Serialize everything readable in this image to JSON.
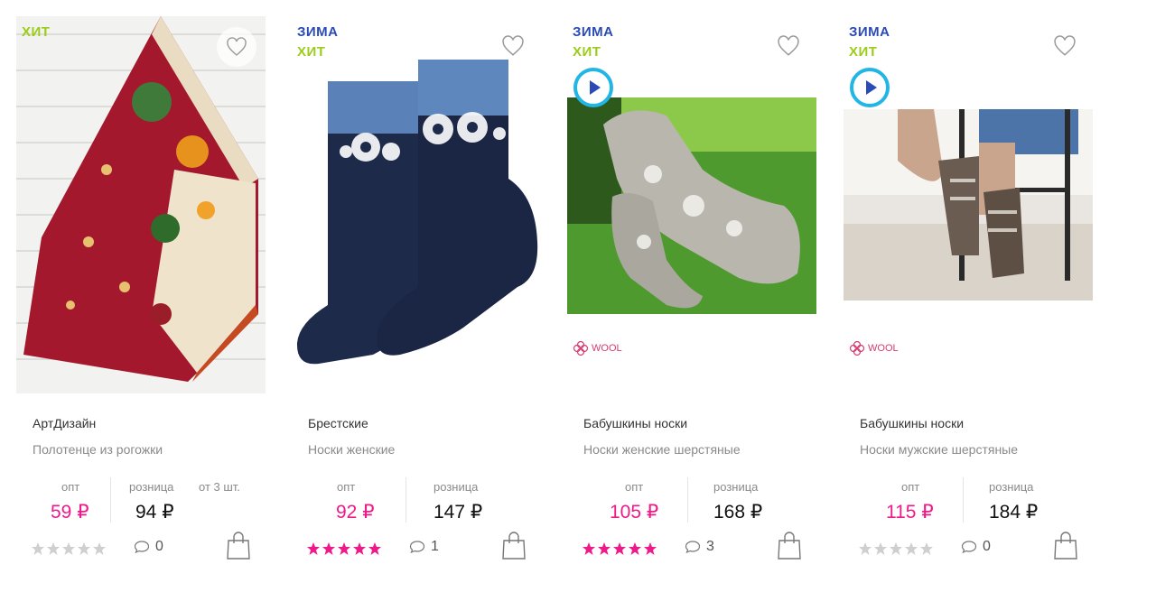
{
  "colors": {
    "accent": "#ef1a8a",
    "zima": "#2a4bb5",
    "hit": "#9ccc1a",
    "wool": "#d63c73",
    "star_empty": "#cfcfcf"
  },
  "labels": {
    "opt": "опт",
    "retail": "розница",
    "currency": "₽",
    "wool": "WOOL"
  },
  "products": [
    {
      "badges": [
        "ХИТ"
      ],
      "brand": "АртДизайн",
      "name": "Полотенце из рогожки",
      "opt_price": "59 ₽",
      "retail_price": "94 ₽",
      "min_qty": "от 3 шт.",
      "rating": 0,
      "comments": "0",
      "has_video": false,
      "wool": false,
      "image": "tea-towel-image"
    },
    {
      "badges": [
        "ЗИМА",
        "ХИТ"
      ],
      "brand": "Брестские",
      "name": "Носки женские",
      "opt_price": "92 ₽",
      "retail_price": "147 ₽",
      "rating": 5,
      "comments": "1",
      "has_video": false,
      "wool": false,
      "image": "navy-socks-image"
    },
    {
      "badges": [
        "ЗИМА",
        "ХИТ"
      ],
      "brand": "Бабушкины носки",
      "name": "Носки женские шерстяные",
      "opt_price": "105 ₽",
      "retail_price": "168 ₽",
      "rating": 5,
      "comments": "3",
      "has_video": true,
      "wool": true,
      "image": "wool-socks-grass-image"
    },
    {
      "badges": [
        "ЗИМА",
        "ХИТ"
      ],
      "brand": "Бабушкины носки",
      "name": "Носки мужские шерстяные",
      "opt_price": "115 ₽",
      "retail_price": "184 ₽",
      "rating": 0,
      "comments": "0",
      "has_video": true,
      "wool": true,
      "image": "mens-socks-chair-image"
    }
  ]
}
